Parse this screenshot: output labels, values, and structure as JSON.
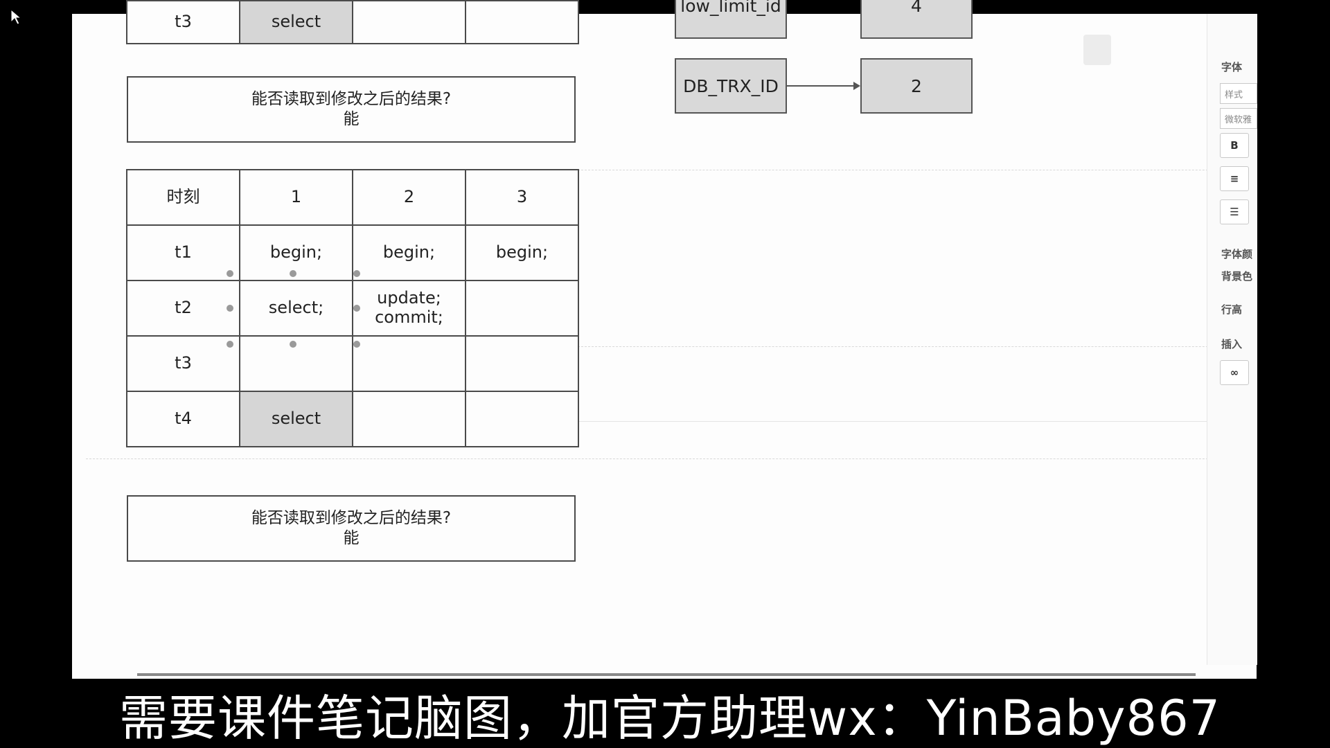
{
  "top_partial_row": {
    "time": "t3",
    "col1": "select",
    "col2": "",
    "col3": ""
  },
  "question_box_top": {
    "question": "能否读取到修改之后的结果?",
    "answer": "能"
  },
  "table": {
    "headers": [
      "时刻",
      "1",
      "2",
      "3"
    ],
    "rows": [
      {
        "time": "t1",
        "c1": "begin;",
        "c2": "begin;",
        "c3": "begin;"
      },
      {
        "time": "t2",
        "c1": "select;",
        "c2": "update;",
        "c2b": "commit;",
        "c3": ""
      },
      {
        "time": "t3",
        "c1": "",
        "c2": "",
        "c3": ""
      },
      {
        "time": "t4",
        "c1": "select",
        "c2": "",
        "c3": ""
      }
    ]
  },
  "question_box_bottom": {
    "question": "能否读取到修改之后的结果?",
    "answer": "能"
  },
  "diagram": {
    "partial_left_label": "low_limit_id",
    "partial_right_label": "4",
    "left_label": "DB_TRX_ID",
    "right_label": "2"
  },
  "side_panel": {
    "font_label": "字体",
    "style_field": "样式",
    "font_field": "微软雅",
    "bold_btn": "B",
    "font_color_label": "字体颜",
    "bg_color_label": "背景色",
    "line_height_label": "行高",
    "insert_label": "插入"
  },
  "subtitle": "需要课件笔记脑图，加官方助理wx：YinBaby867"
}
